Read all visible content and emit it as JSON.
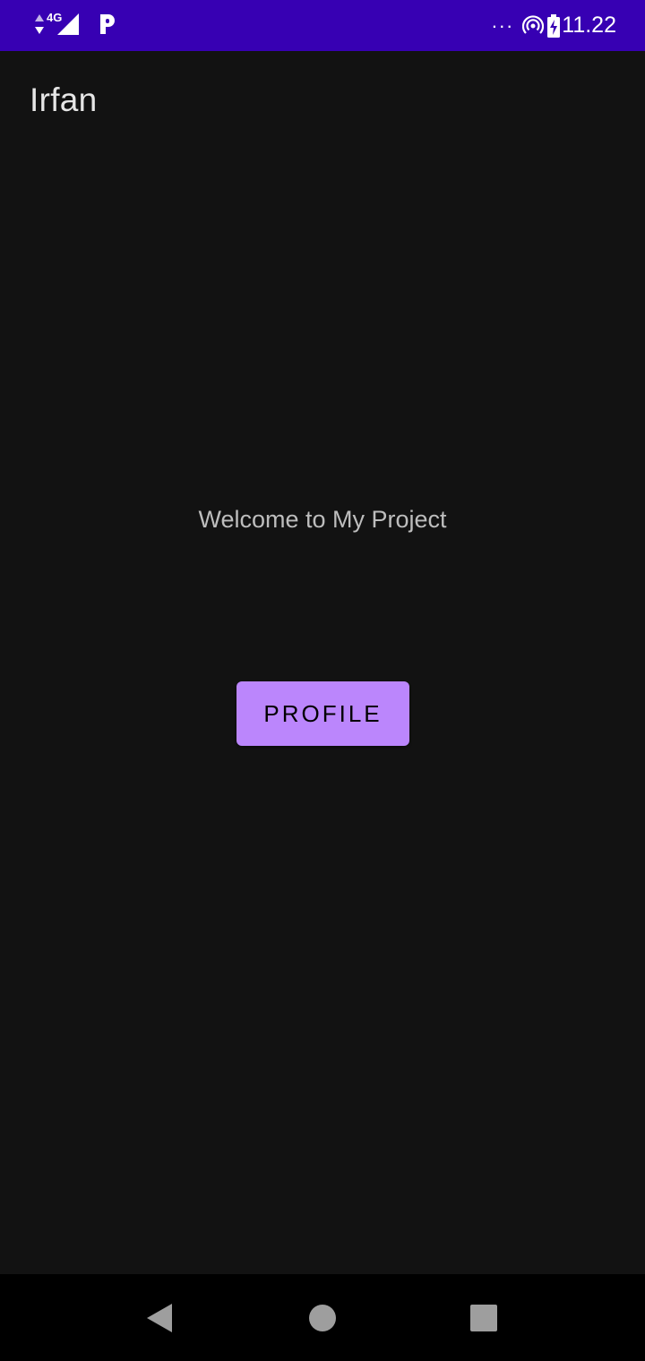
{
  "status_bar": {
    "network_label": "4G",
    "time": "11.22",
    "overflow_dots": "···",
    "background_color": "#3700b3"
  },
  "app_bar": {
    "title": "Irfan"
  },
  "main": {
    "welcome_text": "Welcome to My Project",
    "profile_button_label": "PROFILE",
    "accent_color": "#bb86fc"
  },
  "nav_bar": {
    "icons": [
      "back-icon",
      "home-icon",
      "recents-icon"
    ]
  }
}
